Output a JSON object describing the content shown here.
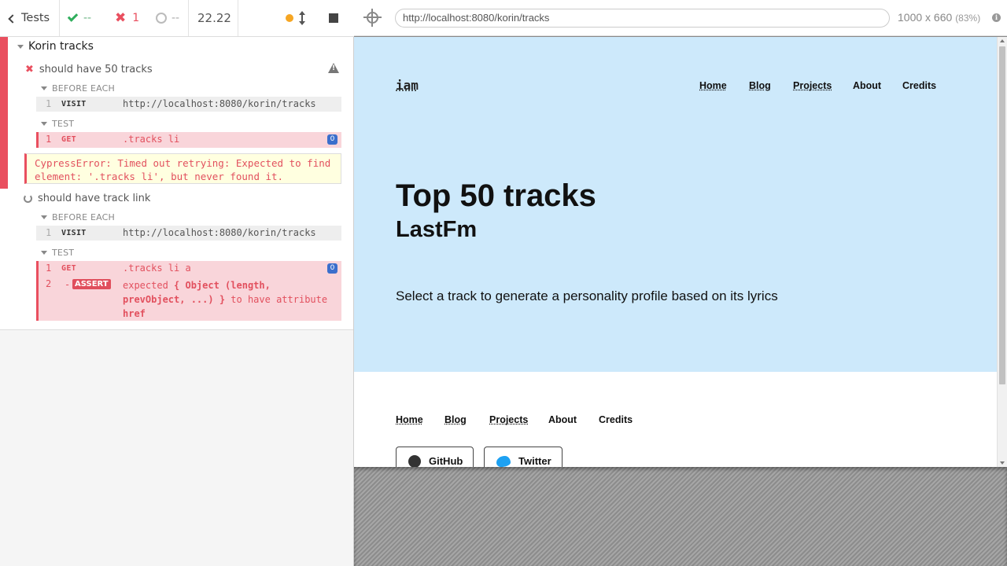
{
  "reporter": {
    "tests_label": "Tests",
    "passed": "--",
    "failed": "1",
    "pending": "--",
    "duration": "22.22",
    "suite_title": "Korin tracks",
    "tests": [
      {
        "title": "should have 50 tracks",
        "state": "failed",
        "hooks": [
          {
            "label": "BEFORE EACH",
            "commands": [
              {
                "num": "1",
                "name": "VISIT",
                "message": "http://localhost:8080/korin/tracks"
              }
            ]
          },
          {
            "label": "TEST",
            "commands": [
              {
                "num": "1",
                "name": "GET",
                "message": ".tracks li",
                "badge": "0"
              }
            ]
          }
        ],
        "error": "CypressError: Timed out retrying: Expected to find element: '.tracks li', but never found it."
      },
      {
        "title": "should have track link",
        "state": "running",
        "hooks": [
          {
            "label": "BEFORE EACH",
            "commands": [
              {
                "num": "1",
                "name": "VISIT",
                "message": "http://localhost:8080/korin/tracks"
              }
            ]
          },
          {
            "label": "TEST",
            "commands": [
              {
                "num": "1",
                "name": "GET",
                "message": ".tracks li a",
                "badge": "0"
              },
              {
                "num": "2",
                "name": "ASSERT",
                "dash": "-",
                "message_parts": [
                  "expected",
                  "{ Object (length,",
                  "prevObject, ...) }",
                  "to have attribute",
                  "href"
                ]
              }
            ]
          }
        ]
      }
    ]
  },
  "aut": {
    "url": "http://localhost:8080/korin/tracks",
    "viewport": "1000 x 660",
    "scale": "(83%)",
    "site": {
      "logo": "iam",
      "nav": [
        "Home",
        "Blog",
        "Projects",
        "About",
        "Credits"
      ],
      "title": "Top 50 tracks",
      "subtitle": "LastFm",
      "description": "Select a track to generate a personality profile based on its lyrics",
      "footer_nav": [
        "Home",
        "Blog",
        "Projects",
        "About",
        "Credits"
      ],
      "social": {
        "github": "GitHub",
        "twitter": "Twitter"
      }
    }
  },
  "colors": {
    "fail": "#e94f5f",
    "pass": "#2fae5c",
    "running": "#f6a623",
    "hero_bg": "#cde9fb"
  }
}
